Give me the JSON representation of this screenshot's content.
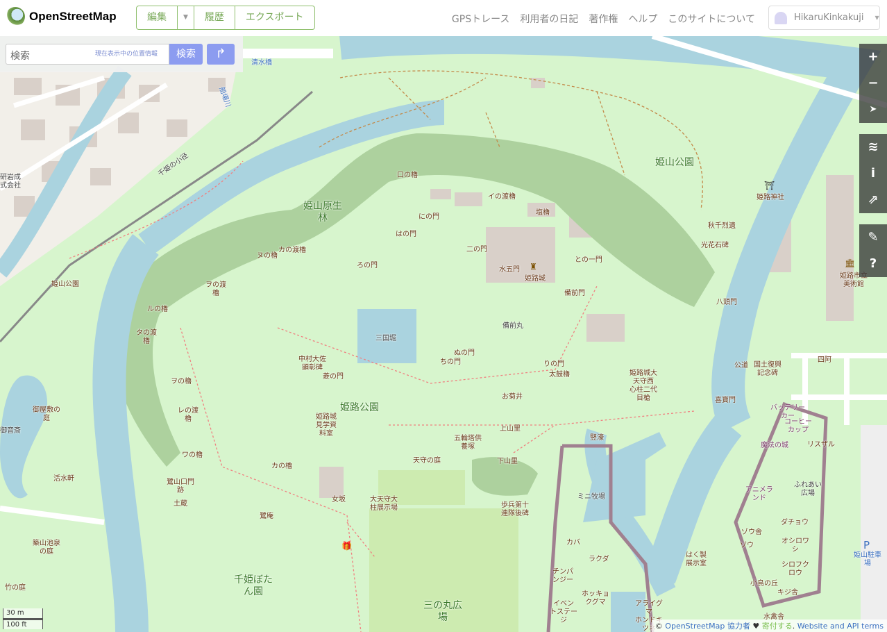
{
  "header": {
    "brand": "OpenStreetMap",
    "edit": "編集",
    "history": "履歴",
    "export": "エクスポート",
    "nav": [
      "GPSトレース",
      "利用者の日記",
      "著作権",
      "ヘルプ",
      "このサイトについて"
    ],
    "user": "HikaruKinkakuji"
  },
  "search": {
    "placeholder": "検索",
    "where_am_i": "現在表示中の位置情報",
    "submit": "検索"
  },
  "controls": {
    "zoom_in": "+",
    "zoom_out": "−",
    "locate": "➤",
    "layers": "≋",
    "info": "i",
    "share": "⇗",
    "note": "✎",
    "query": "?"
  },
  "attribution": {
    "copy": "©",
    "osm": "OpenStreetMap",
    "contributors": "協力者",
    "heart": "♥",
    "donate": "寄付する",
    "sep": ".",
    "terms": "Website and API terms"
  },
  "scale": {
    "metric": "30 m",
    "imperial": "100 ft"
  },
  "colors": {
    "park": "#d7f5cd",
    "water": "#aad3df",
    "forest": "#add19e",
    "urban": "#f2efe9",
    "building": "#d9d0c9",
    "accent": "#7ebc6f"
  },
  "map": {
    "labels": [
      "清水橋",
      "千姫の小径",
      "姫山原生\n林",
      "姫山公園",
      "姫路神社",
      "口の櫓",
      "イの渡櫓",
      "にの門",
      "はの門",
      "塩櫓",
      "ヌの櫓",
      "カの渡櫓",
      "ろの門",
      "二の門",
      "水五門",
      "姫路城",
      "との一門",
      "備前門",
      "備前丸",
      "ヲの渡\n櫓",
      "ルの櫓",
      "タの渡\n櫓",
      "三国堀",
      "中村大佐\n顕彰碑",
      "ぬの門",
      "ちの門",
      "りの門",
      "太鼓櫓",
      "ヲの櫓",
      "菱の門",
      "姫路公園",
      "レの渡\n櫓",
      "姫路城\n見学資\n料室",
      "五輪塔供\n養塚",
      "上山里",
      "お菊井",
      "姫路城大\n天守西\n心柱二代\n目槍",
      "竪濠",
      "ワの櫓",
      "カの櫓",
      "天守の庭",
      "下山里",
      "鷺山口門\n跡",
      "土蔵",
      "女坂",
      "大天守大\n柱展示場",
      "歩兵第十\n連隊後碑",
      "鷺庵",
      "千姫ぼた\nん園",
      "三の丸広\n場",
      "御屋敷の\n庭",
      "活水軒",
      "築山池泉\nの庭",
      "竹の庭",
      "姫山公園",
      "秋千烈遺",
      "光花石碑",
      "八頭門",
      "国土復興\n記念碑",
      "公道",
      "喜寶門",
      "四阿",
      "姫路市立\n美術館",
      "姫山駐車\n場",
      "バッテリー\nカー",
      "コーヒー\nカップ",
      "魔法の城",
      "リスザル",
      "アニメラ\nンド",
      "ふれあい\n広場",
      "ダチョウ",
      "ゾウ舎",
      "ゾウ",
      "オシロワ\nシ",
      "シロフク\nロウ",
      "小鳥の丘",
      "キジ舎",
      "水禽舎",
      "はく製\n展示室",
      "カバ",
      "ラクダ",
      "チンパ\nンジー",
      "ミニ牧場",
      "イベン\nトステー\nジ",
      "ホッキョ\nクグマ",
      "アライグ\nマ\nホンドキ\nツネ",
      "船場川",
      "御音斎",
      "研岩成\n式会社"
    ]
  }
}
